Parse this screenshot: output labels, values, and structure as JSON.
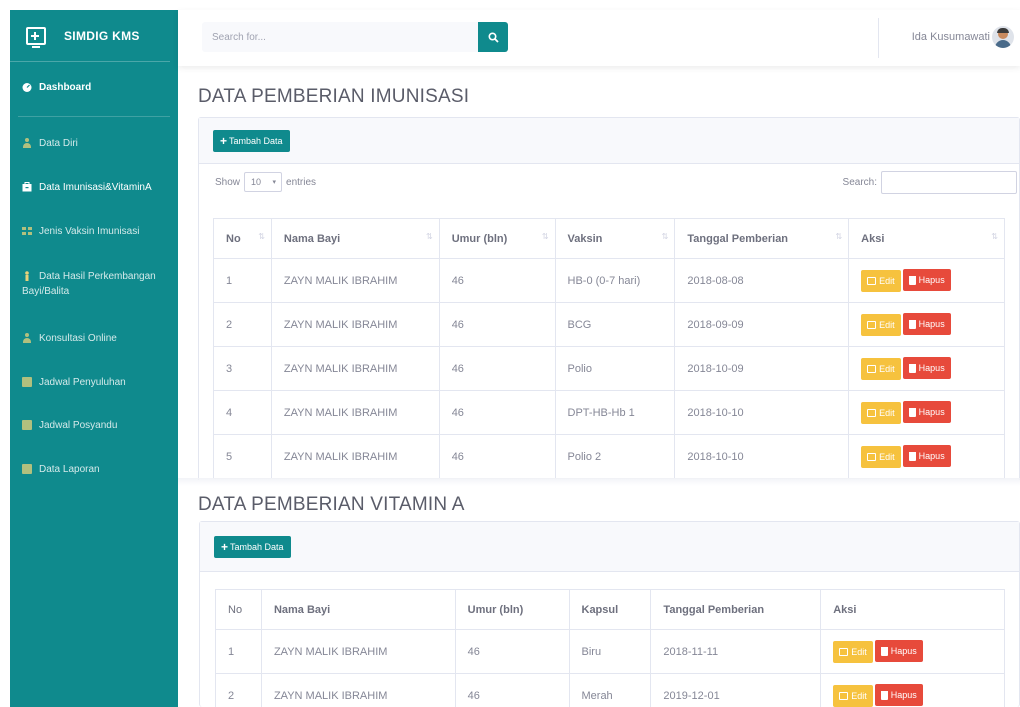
{
  "brand": {
    "title": "SIMDIG KMS"
  },
  "sidebar": {
    "dashboard": "Dashboard",
    "items": [
      {
        "label": "Data Diri",
        "icon": "user-icon"
      },
      {
        "label": "Data Imunisasi&VitaminA",
        "icon": "box-icon"
      },
      {
        "label": "Jenis Vaksin Imunisasi",
        "icon": "list-icon"
      },
      {
        "label": "Data Hasil Perkembangan Bayi/Balita",
        "icon": "child-icon"
      },
      {
        "label": "Konsultasi Online",
        "icon": "user-icon"
      },
      {
        "label": "Jadwal Penyuluhan",
        "icon": "table-icon"
      },
      {
        "label": "Jadwal Posyandu",
        "icon": "table-icon"
      },
      {
        "label": "Data Laporan",
        "icon": "table-icon"
      }
    ]
  },
  "topbar": {
    "search_placeholder": "Search for...",
    "user_name": "Ida Kusumawati"
  },
  "imunisasi": {
    "title": "DATA PEMBERIAN IMUNISASI",
    "add_label": "Tambah Data",
    "show_label": "Show",
    "entries_value": "10",
    "entries_label": "entries",
    "search_label": "Search:",
    "columns": [
      "No",
      "Nama Bayi",
      "Umur (bln)",
      "Vaksin",
      "Tanggal Pemberian",
      "Aksi"
    ],
    "rows": [
      {
        "no": "1",
        "nama": "ZAYN MALIK IBRAHIM",
        "umur": "46",
        "vaksin": "HB-0 (0-7 hari)",
        "tanggal": "2018-08-08"
      },
      {
        "no": "2",
        "nama": "ZAYN MALIK IBRAHIM",
        "umur": "46",
        "vaksin": "BCG",
        "tanggal": "2018-09-09"
      },
      {
        "no": "3",
        "nama": "ZAYN MALIK IBRAHIM",
        "umur": "46",
        "vaksin": "Polio",
        "tanggal": "2018-10-09"
      },
      {
        "no": "4",
        "nama": "ZAYN MALIK IBRAHIM",
        "umur": "46",
        "vaksin": "DPT-HB-Hb 1",
        "tanggal": "2018-10-10"
      },
      {
        "no": "5",
        "nama": "ZAYN MALIK IBRAHIM",
        "umur": "46",
        "vaksin": "Polio 2",
        "tanggal": "2018-10-10"
      }
    ],
    "edit_label": "Edit",
    "hapus_label": "Hapus"
  },
  "vitamin": {
    "title": "DATA PEMBERIAN VITAMIN A",
    "add_label": "Tambah Data",
    "columns": [
      "No",
      "Nama Bayi",
      "Umur (bln)",
      "Kapsul",
      "Tanggal Pemberian",
      "Aksi"
    ],
    "rows": [
      {
        "no": "1",
        "nama": "ZAYN MALIK IBRAHIM",
        "umur": "46",
        "kapsul": "Biru",
        "tanggal": "2018-11-11"
      },
      {
        "no": "2",
        "nama": "ZAYN MALIK IBRAHIM",
        "umur": "46",
        "kapsul": "Merah",
        "tanggal": "2019-12-01"
      }
    ],
    "edit_label": "Edit",
    "hapus_label": "Hapus"
  },
  "colors": {
    "primary": "#0f8a8d",
    "warning": "#f6c23e",
    "danger": "#e74a3b"
  }
}
